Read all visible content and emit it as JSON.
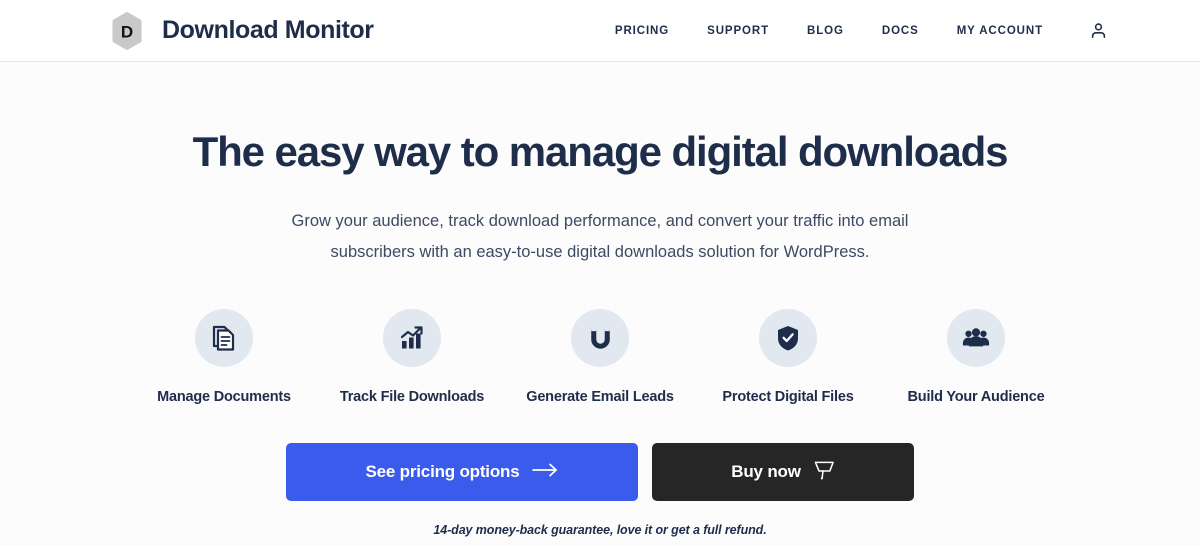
{
  "header": {
    "brand": {
      "mark_letter": "D",
      "mark_icon": "hexagon-logo-icon",
      "name": "Download Monitor"
    },
    "nav": [
      {
        "label": "PRICING",
        "name": "nav-link-pricing"
      },
      {
        "label": "SUPPORT",
        "name": "nav-link-support"
      },
      {
        "label": "BLOG",
        "name": "nav-link-blog"
      },
      {
        "label": "DOCS",
        "name": "nav-link-docs"
      },
      {
        "label": "MY ACCOUNT",
        "name": "nav-link-my-account"
      }
    ],
    "account_icon": "person-icon"
  },
  "hero": {
    "title": "The easy way to manage digital downloads",
    "subtitle_line1": "Grow your audience, track download performance, and convert your traffic into email",
    "subtitle_line2": "subscribers with an easy-to-use digital downloads solution for WordPress.",
    "features": [
      {
        "label": "Manage Documents",
        "icon": "documents-icon"
      },
      {
        "label": "Track File Downloads",
        "icon": "bar-chart-trend-icon"
      },
      {
        "label": "Generate Email Leads",
        "icon": "magnet-icon"
      },
      {
        "label": "Protect Digital Files",
        "icon": "shield-check-icon"
      },
      {
        "label": "Build Your Audience",
        "icon": "people-group-icon"
      }
    ],
    "cta": {
      "primary_label": "See pricing options",
      "primary_icon": "arrow-right-icon",
      "secondary_label": "Buy now",
      "secondary_icon": "shopping-cart-icon"
    },
    "guarantee": "14-day money-back guarantee, love it or get a full refund."
  },
  "colors": {
    "accent_blue": "#3a5beb",
    "dark_button": "#262626",
    "navy_text": "#1e2d4a",
    "badge_bg": "#e2e8ef"
  }
}
